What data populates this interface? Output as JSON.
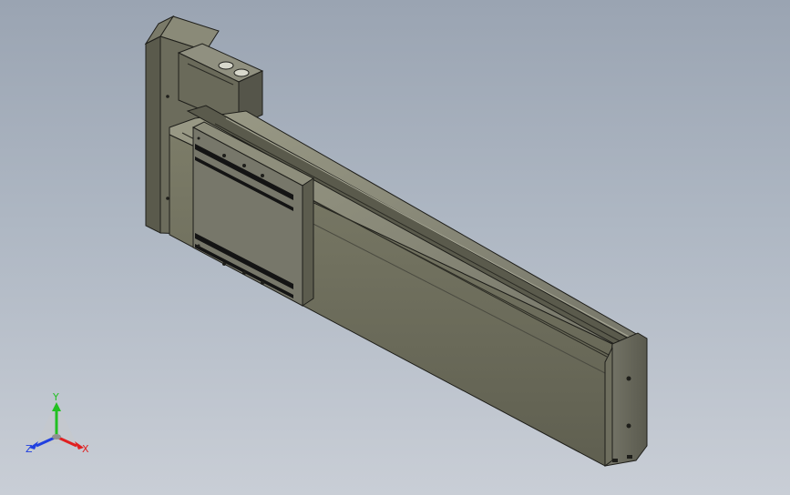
{
  "viewport": {
    "background_top": "#9aa4b2",
    "background_bottom": "#c9ced6"
  },
  "model": {
    "body_color": "#6f6f5e",
    "body_light": "#8a8a77",
    "body_dark": "#4f4f43",
    "motor_color": "#6b6b5b",
    "outline_color": "#1e1e1a",
    "slot_color": "#141414"
  },
  "triad": {
    "y_label": "Y",
    "x_label": "X",
    "z_label": "Z",
    "y_color": "#22c022",
    "x_color": "#e02020",
    "z_color": "#2040e0"
  }
}
